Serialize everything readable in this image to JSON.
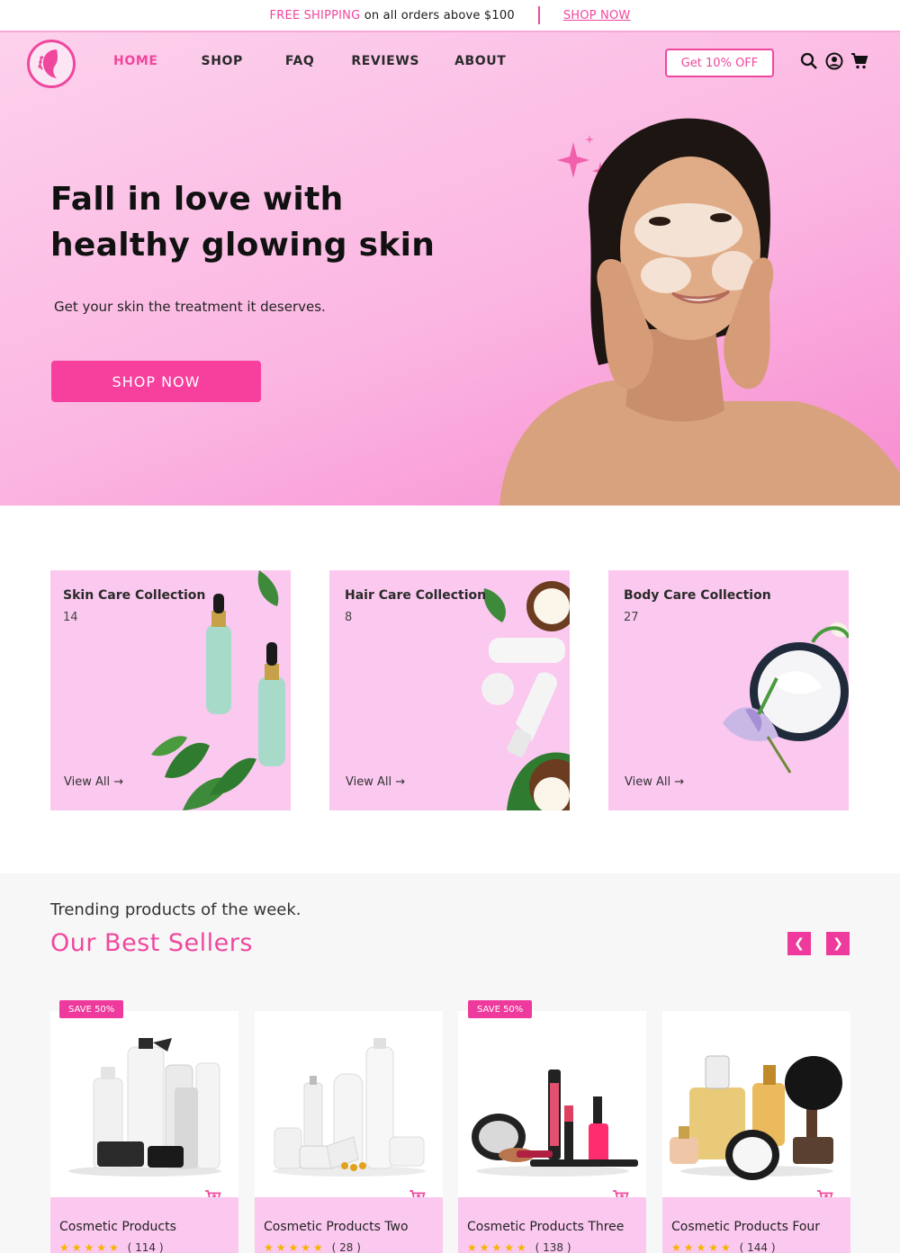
{
  "announcement": {
    "highlight": "FREE SHIPPING",
    "text": " on all orders above $100",
    "link": "SHOP NOW"
  },
  "nav": {
    "items": [
      "HOME",
      "SHOP",
      "FAQ",
      "REVIEWS",
      "ABOUT"
    ],
    "promo": "Get 10% OFF",
    "icons": [
      "search-icon",
      "account-icon",
      "cart-icon"
    ]
  },
  "hero": {
    "title_line1": "Fall in love with",
    "title_line2": "healthy glowing skin",
    "subtitle": "Get your skin the treatment it deserves.",
    "cta": "SHOP NOW"
  },
  "collections": [
    {
      "title": "Skin Care Collection",
      "count": "14",
      "link": "View All"
    },
    {
      "title": "Hair Care Collection",
      "count": "8",
      "link": "View All"
    },
    {
      "title": "Body Care Collection",
      "count": "27",
      "link": "View All"
    }
  ],
  "bestsellers": {
    "kicker": "Trending products of the week.",
    "heading": "Our Best Sellers",
    "badge": "SAVE 50%",
    "products": [
      {
        "name": "Cosmetic Products",
        "rating": 5,
        "reviews": "( 114 )",
        "badge": true
      },
      {
        "name": "Cosmetic Products Two",
        "rating": 5,
        "reviews": "( 28 )",
        "badge": false
      },
      {
        "name": "Cosmetic Products Three",
        "rating": 5,
        "reviews": "( 138 )",
        "badge": true
      },
      {
        "name": "Cosmetic Products Four",
        "rating": 5,
        "reviews": "( 144 )",
        "badge": false
      }
    ]
  },
  "colors": {
    "accent": "#f0479e",
    "hero_bg": "#fbb6e2",
    "card_bg": "#fbc8ef",
    "star": "#f5b400"
  }
}
